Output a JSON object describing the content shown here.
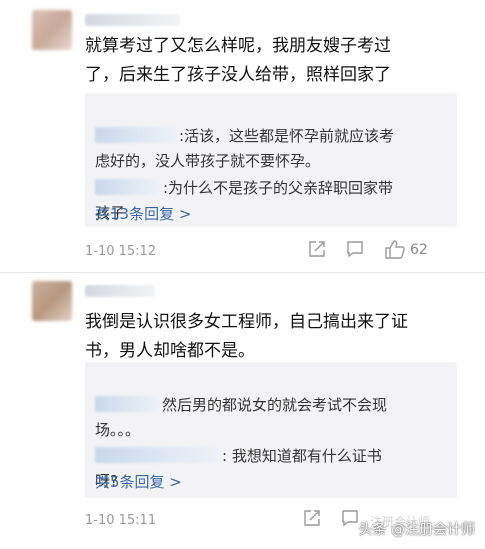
{
  "comment1": {
    "text": "就算考过了又怎么样呢，我朋友嫂子考过\n了，后来生了孩子没人给带，照样回家了",
    "replies": [
      {
        "text": ":活该，这些都是怀孕前就应该考\n虑好的，没人带孩子就不要怀孕。"
      },
      {
        "text": ":为什么不是孩子的父亲辞职回家带\n孩子"
      }
    ],
    "more_replies": "共13条回复 >",
    "time": "1-10 15:12",
    "like_count": "62"
  },
  "comment2": {
    "text": "我倒是认识很多女工程师，自己搞出来了证\n书，男人却啥都不是。",
    "replies": [
      {
        "text": "然后男的都说女的就会考试不会现\n场。。。"
      },
      {
        "text": ": 我想知道都有什么证书\n呀?"
      }
    ],
    "more_replies": "共5条回复 >",
    "time": "1-10 15:11",
    "faded_mark": "注册会计师"
  },
  "watermark": "头条 @注册会计师",
  "colors": {
    "link": "#3a68a6",
    "reply_bg": "#f3f3f5",
    "meta": "#9a9a9a"
  }
}
